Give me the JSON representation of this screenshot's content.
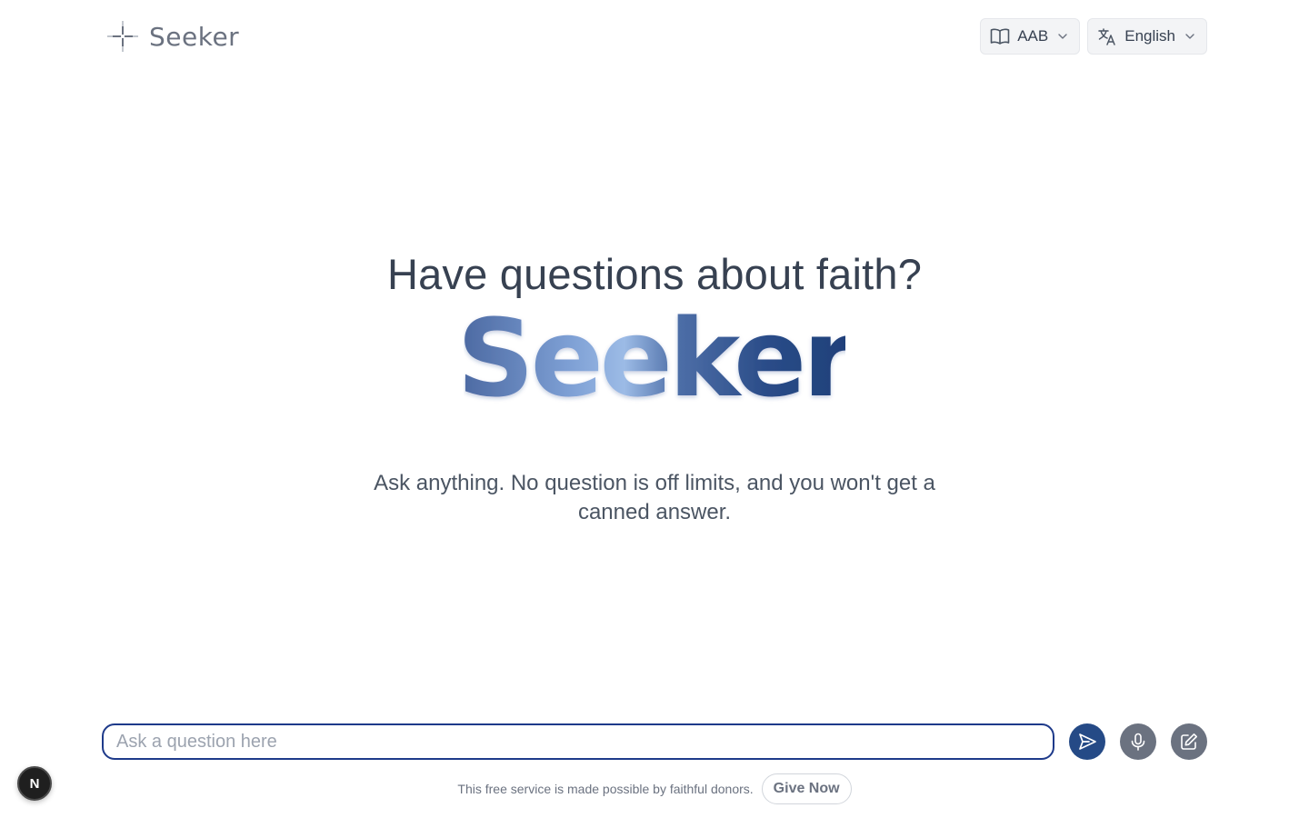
{
  "brand": {
    "name": "Seeker",
    "logo_icon": "sparkle-icon"
  },
  "header": {
    "translation_select": {
      "value": "AAB",
      "icon": "book-icon"
    },
    "language_select": {
      "value": "English",
      "icon": "translate-icon"
    }
  },
  "hero": {
    "title": "Have questions about faith?",
    "wordmark": "Seeker",
    "subtitle": "Ask anything. No question is off limits, and you won't get a canned answer."
  },
  "composer": {
    "placeholder": "Ask a question here",
    "value": "",
    "send_icon": "send-icon",
    "mic_icon": "microphone-icon",
    "edit_icon": "pencil-square-icon"
  },
  "footer": {
    "text": "This free service is made possible by faithful donors.",
    "give_label": "Give Now"
  },
  "badge": {
    "letter": "N"
  },
  "colors": {
    "accent": "#254a86",
    "wordmark_gradient": [
      "#4a67a0",
      "#8fb0e0",
      "#1e3f78"
    ],
    "muted": "#6b7280"
  }
}
